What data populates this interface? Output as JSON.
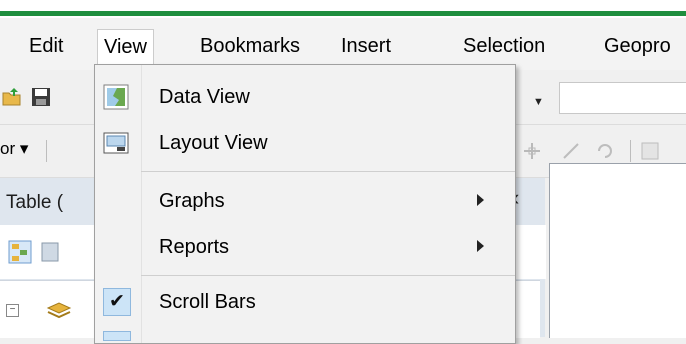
{
  "colors": {
    "accent": "#1e8e3e"
  },
  "menubar": {
    "items": [
      {
        "label": "Edit"
      },
      {
        "label": "View"
      },
      {
        "label": "Bookmarks"
      },
      {
        "label": "Insert"
      },
      {
        "label": "Selection"
      },
      {
        "label": "Geopro"
      }
    ]
  },
  "toolbar2": {
    "left_label": "or ▾"
  },
  "panel": {
    "title": "Table ("
  },
  "view_menu": {
    "items": [
      {
        "label": "Data View",
        "icon": "data-view-icon"
      },
      {
        "label": "Layout View",
        "icon": "layout-view-icon"
      },
      {
        "label": "Graphs",
        "submenu": true
      },
      {
        "label": "Reports",
        "submenu": true
      },
      {
        "label": "Scroll Bars",
        "checked": true
      }
    ]
  }
}
